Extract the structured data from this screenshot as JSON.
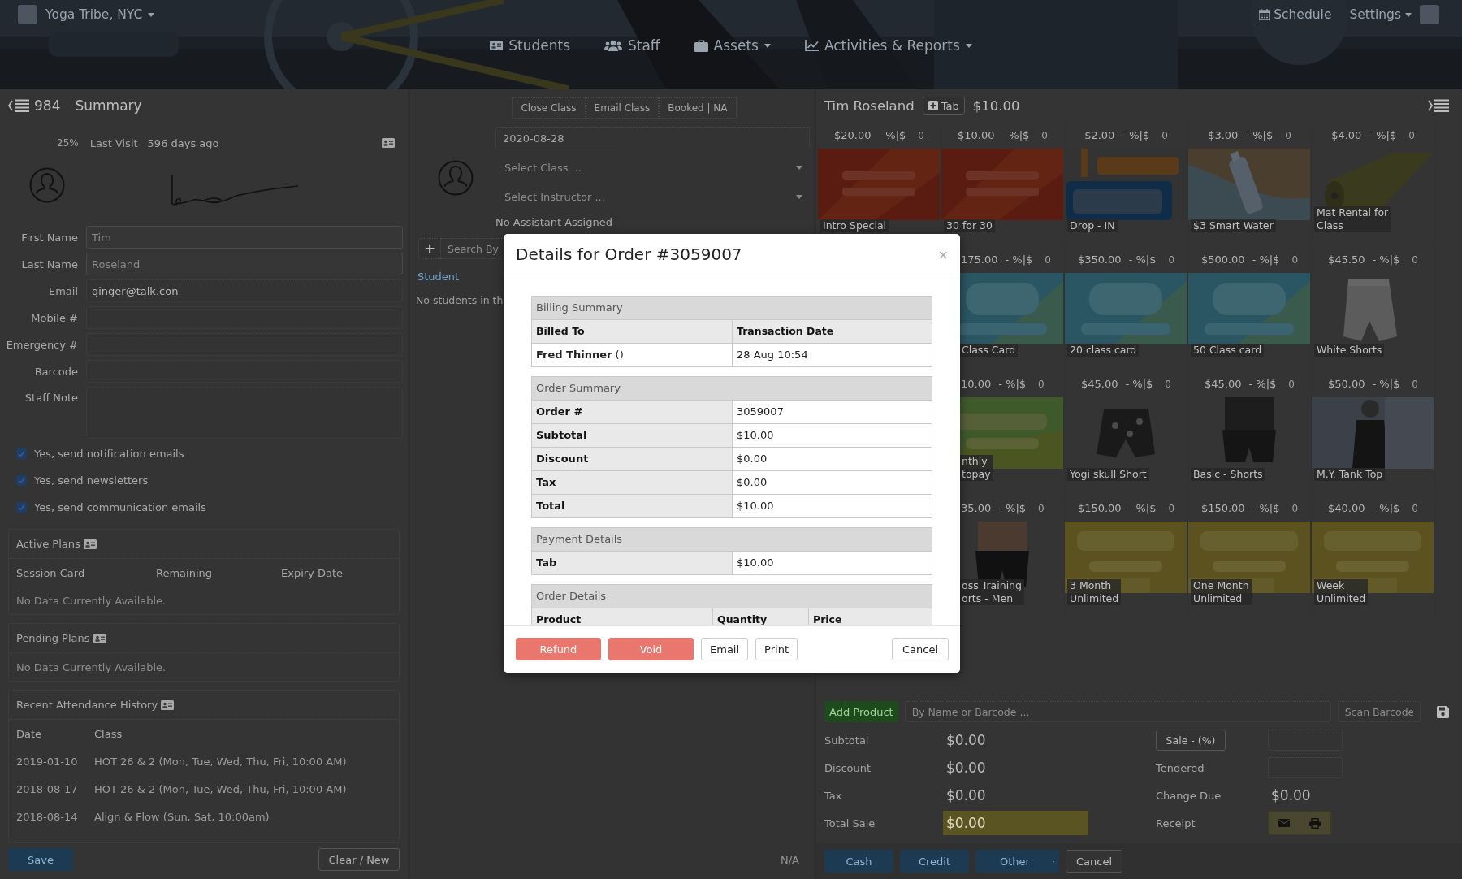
{
  "header": {
    "brand": "Yoga Tribe, NYC",
    "nav": [
      {
        "label": "Students",
        "dropdown": false
      },
      {
        "label": "Staff",
        "dropdown": false
      },
      {
        "label": "Assets",
        "dropdown": true
      },
      {
        "label": "Activities & Reports",
        "dropdown": true
      }
    ],
    "schedule": "Schedule",
    "settings": "Settings"
  },
  "client": {
    "count": "984",
    "title": "Summary",
    "progress": "25%",
    "last_visit_label": "Last Visit",
    "last_visit": "596 days ago",
    "fields": [
      {
        "label": "First Name",
        "kind": "input",
        "placeholder": "Tim"
      },
      {
        "label": "Last Name",
        "kind": "input",
        "placeholder": "Roseland"
      },
      {
        "label": "Email",
        "kind": "text",
        "value": "ginger@talk.con"
      },
      {
        "label": "Mobile #",
        "kind": "text"
      },
      {
        "label": "Emergency #",
        "kind": "text"
      },
      {
        "label": "Barcode",
        "kind": "text"
      },
      {
        "label": "Staff Note",
        "kind": "textarea"
      }
    ],
    "checkboxes": [
      {
        "label": "Yes, send notification emails",
        "checked": true
      },
      {
        "label": "Yes, send newsletters",
        "checked": true
      },
      {
        "label": "Yes, send communication emails",
        "checked": true
      }
    ],
    "active_plans": {
      "title": "Active Plans",
      "columns": [
        "Session Card",
        "Remaining",
        "Expiry Date"
      ],
      "empty": "No Data Currently Available."
    },
    "pending_plans": {
      "title": "Pending Plans",
      "empty": "No Data Currently Available."
    },
    "attendance": {
      "title": "Recent Attendance History",
      "columns": [
        "Date",
        "Class"
      ],
      "rows": [
        [
          "2019-01-10",
          "HOT 26 & 2 (Mon, Tue, Wed, Thu, Fri, 10:00 AM)"
        ],
        [
          "2018-08-17",
          "HOT 26 & 2 (Mon, Tue, Wed, Thu, Fri, 10:00 AM)"
        ],
        [
          "2018-08-14",
          "Align & Flow (Sun, Sat, 10:00am)"
        ]
      ]
    },
    "save": "Save",
    "clear": "Clear / New"
  },
  "class_panel": {
    "tabs": [
      "Close Class",
      "Email Class",
      "Booked | NA"
    ],
    "date": "2020-08-28",
    "class_placeholder": "Select Class ...",
    "instructor_placeholder": "Select Instructor ...",
    "assistant": "No Assistant Assigned",
    "add": "+",
    "search_placeholder": "Search By",
    "student_link": "Student",
    "empty": "No students in th",
    "footer": "N/A"
  },
  "pos": {
    "customer": "Tim Roseland",
    "tab": "Tab",
    "balance": "$10.00",
    "products": [
      [
        {
          "price": "$20.00",
          "discount": "- %|$",
          "qty": "0",
          "name": "Intro Special"
        },
        {
          "price": "$10.00",
          "discount": "- %|$",
          "qty": "0",
          "name": "30 for 30"
        },
        {
          "price": "$2.00",
          "discount": "- %|$",
          "qty": "0",
          "name": "Drop - IN"
        },
        {
          "price": "$3.00",
          "discount": "- %|$",
          "qty": "0",
          "name": "$3 Smart Water"
        },
        {
          "price": "$4.00",
          "discount": "- %|$",
          "qty": "0",
          "name": "Mat Rental for\nClass"
        }
      ],
      [
        {
          "price": "175.00",
          "discount": "- %|$",
          "qty": "0",
          "name": "Class Card"
        },
        {
          "price": "$350.00",
          "discount": "- %|$",
          "qty": "0",
          "name": "20 class card"
        },
        {
          "price": "$500.00",
          "discount": "- %|$",
          "qty": "0",
          "name": "50 Class card"
        },
        {
          "price": "$45.50",
          "discount": "- %|$",
          "qty": "0",
          "name": "White Shorts"
        }
      ],
      [
        {
          "price": "10.00",
          "discount": "- %|$",
          "qty": "0",
          "name": "nthly\ntopay"
        },
        {
          "price": "$45.00",
          "discount": "- %|$",
          "qty": "0",
          "name": "Yogi skull Short"
        },
        {
          "price": "$45.00",
          "discount": "- %|$",
          "qty": "0",
          "name": "Basic - Shorts"
        },
        {
          "price": "$50.00",
          "discount": "- %|$",
          "qty": "0",
          "name": "M.Y. Tank Top"
        }
      ],
      [
        {
          "price": "35.00",
          "discount": "- %|$",
          "qty": "0",
          "name": "oss Training\norts - Men"
        },
        {
          "price": "$150.00",
          "discount": "- %|$",
          "qty": "0",
          "name": "3 Month\nUnlimited"
        },
        {
          "price": "$150.00",
          "discount": "- %|$",
          "qty": "0",
          "name": "One Month\nUnlimited"
        },
        {
          "price": "$40.00",
          "discount": "- %|$",
          "qty": "0",
          "name": "Week\nUnlimited"
        }
      ]
    ],
    "add_product": "Add Product",
    "search_placeholder": "By Name or Barcode ...",
    "scan_placeholder": "Scan Barcode",
    "totals": [
      {
        "label": "Subtotal",
        "value": "$0.00",
        "highlighted": false
      },
      {
        "label": "Discount",
        "value": "$0.00",
        "highlighted": false
      },
      {
        "label": "Tax",
        "value": "$0.00",
        "highlighted": false
      },
      {
        "label": "Total Sale",
        "value": "$0.00",
        "highlighted": true
      }
    ],
    "sale": "Sale - (%)",
    "tendered": "Tendered",
    "change_due": "Change Due",
    "change_value": "$0.00",
    "receipt": "Receipt",
    "pay_buttons": [
      {
        "label": "Cash",
        "kind": "primary"
      },
      {
        "label": "Credit",
        "kind": "primary"
      },
      {
        "label": "Other",
        "kind": "split"
      },
      {
        "label": "Cancel",
        "kind": "plain"
      }
    ]
  },
  "modal": {
    "title": "Details for Order #3059007",
    "close": "×",
    "sections": [
      {
        "title": "Billing Summary",
        "kind": "columns",
        "header": [
          "Billed To",
          "Transaction Date"
        ],
        "rows": [
          [
            "**Fred Thinner** ()",
            "28 Aug 10:54"
          ]
        ]
      },
      {
        "title": "Order Summary",
        "kind": "pairs",
        "rows": [
          [
            "Order #",
            "3059007"
          ],
          [
            "Subtotal",
            "$10.00"
          ],
          [
            "Discount",
            "$0.00"
          ],
          [
            "Tax",
            "$0.00"
          ],
          [
            "Total",
            "$10.00"
          ]
        ]
      },
      {
        "title": "Payment Details",
        "kind": "pairs",
        "rows": [
          [
            "Tab",
            "$10.00"
          ]
        ]
      },
      {
        "title": "Order Details",
        "kind": "columns",
        "header": [
          "Product",
          "Quantity",
          "Price"
        ]
      }
    ],
    "buttons": [
      {
        "label": "Refund",
        "kind": "danger"
      },
      {
        "label": "Void",
        "kind": "danger"
      },
      {
        "label": "Email",
        "kind": "default"
      },
      {
        "label": "Print",
        "kind": "default"
      },
      {
        "label": "Cancel",
        "kind": "dismiss"
      }
    ]
  }
}
